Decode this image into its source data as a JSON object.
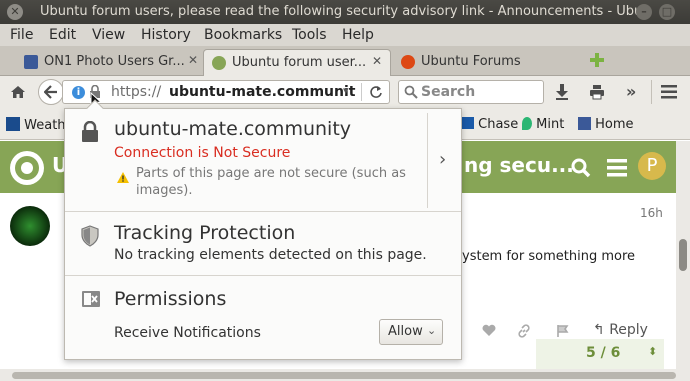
{
  "window": {
    "title": "Ubuntu forum users, please read the following security advisory link - Announcements - Ubu"
  },
  "menu": [
    "File",
    "Edit",
    "View",
    "History",
    "Bookmarks",
    "Tools",
    "Help"
  ],
  "tabs": [
    {
      "label": "ON1 Photo Users Gr...",
      "favicon_color": "#3b5998"
    },
    {
      "label": "Ubuntu forum user...",
      "favicon_color": "#87a556"
    },
    {
      "label": "Ubuntu Forums",
      "favicon_color": "#dd4814"
    }
  ],
  "navbar": {
    "url_prefix": "https://",
    "url_host": "ubuntu-mate.communit",
    "search_placeholder": "Search"
  },
  "bookmarks": [
    "Weather",
    "Chase",
    "Mint",
    "Home"
  ],
  "page": {
    "header_visible_text_left": "U",
    "header_visible_text_right": "ng secu...",
    "avatar_letter": "P",
    "post_time": "16h",
    "post_snippet": "ystem for something more",
    "reply_label": "Reply",
    "progress": "5 / 6"
  },
  "popup": {
    "site": "ubuntu-mate.community",
    "connection_status": "Connection is Not Secure",
    "warning": "Parts of this page are not secure (such as images).",
    "tracking_title": "Tracking Protection",
    "tracking_desc": "No tracking elements detected on this page.",
    "permissions_title": "Permissions",
    "permission_item": "Receive Notifications",
    "permission_value": "Allow"
  },
  "colors": {
    "accent_green": "#87a556",
    "warning_red": "#d92d21",
    "warning_yellow": "#f5c000"
  }
}
